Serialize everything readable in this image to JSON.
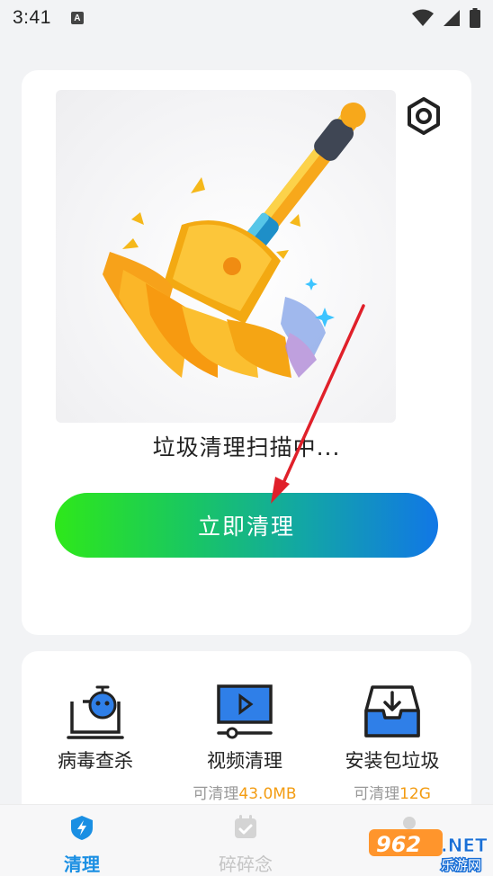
{
  "status_bar": {
    "time": "3:41",
    "badge": "A"
  },
  "main_card": {
    "scan_status": "垃圾清理扫描中...",
    "clean_button_label": "立即清理"
  },
  "tools": [
    {
      "label": "病毒查杀",
      "sub_prefix": "",
      "sub_value": ""
    },
    {
      "label": "视频清理",
      "sub_prefix": "可清理",
      "sub_value": "43.0MB"
    },
    {
      "label": "安装包垃圾",
      "sub_prefix": "可清理",
      "sub_value": "12G"
    }
  ],
  "bottom_nav": [
    {
      "label": "清理",
      "active": true
    },
    {
      "label": "碎碎念",
      "active": false
    }
  ],
  "watermark": {
    "number": "962",
    "suffix": ".NET",
    "sub": "乐游网"
  },
  "colors": {
    "accent": "#1a8fe3",
    "highlight": "#f39c12",
    "arrow": "#e0202a"
  }
}
